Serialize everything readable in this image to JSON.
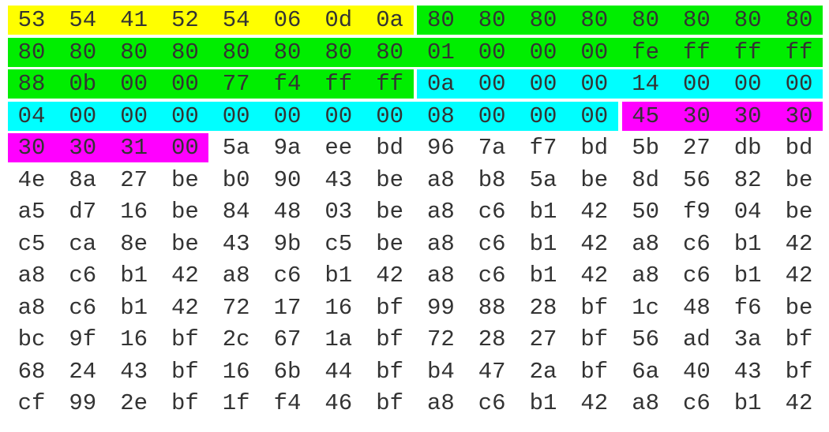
{
  "highlight_colors": {
    "yellow": "#ffff00",
    "green": "#00ee00",
    "cyan": "#00ffff",
    "magenta": "#ff00ff"
  },
  "text_color": "#333333",
  "rows": [
    {
      "bytes": [
        "53",
        "54",
        "41",
        "52",
        "54",
        "06",
        "0d",
        "0a",
        "80",
        "80",
        "80",
        "80",
        "80",
        "80",
        "80",
        "80"
      ],
      "highlights": [
        {
          "start": 0,
          "end": 7,
          "color": "yellow"
        },
        {
          "start": 8,
          "end": 15,
          "color": "green"
        }
      ]
    },
    {
      "bytes": [
        "80",
        "80",
        "80",
        "80",
        "80",
        "80",
        "80",
        "80",
        "01",
        "00",
        "00",
        "00",
        "fe",
        "ff",
        "ff",
        "ff"
      ],
      "highlights": [
        {
          "start": 0,
          "end": 15,
          "color": "green"
        }
      ]
    },
    {
      "bytes": [
        "88",
        "0b",
        "00",
        "00",
        "77",
        "f4",
        "ff",
        "ff",
        "0a",
        "00",
        "00",
        "00",
        "14",
        "00",
        "00",
        "00"
      ],
      "highlights": [
        {
          "start": 0,
          "end": 7,
          "color": "green"
        },
        {
          "start": 8,
          "end": 15,
          "color": "cyan"
        }
      ]
    },
    {
      "bytes": [
        "04",
        "00",
        "00",
        "00",
        "00",
        "00",
        "00",
        "00",
        "08",
        "00",
        "00",
        "00",
        "45",
        "30",
        "30",
        "30"
      ],
      "highlights": [
        {
          "start": 0,
          "end": 11,
          "color": "cyan"
        },
        {
          "start": 12,
          "end": 15,
          "color": "magenta"
        }
      ]
    },
    {
      "bytes": [
        "30",
        "30",
        "31",
        "00",
        "5a",
        "9a",
        "ee",
        "bd",
        "96",
        "7a",
        "f7",
        "bd",
        "5b",
        "27",
        "db",
        "bd"
      ],
      "highlights": [
        {
          "start": 0,
          "end": 3,
          "color": "magenta"
        }
      ]
    },
    {
      "bytes": [
        "4e",
        "8a",
        "27",
        "be",
        "b0",
        "90",
        "43",
        "be",
        "a8",
        "b8",
        "5a",
        "be",
        "8d",
        "56",
        "82",
        "be"
      ],
      "highlights": []
    },
    {
      "bytes": [
        "a5",
        "d7",
        "16",
        "be",
        "84",
        "48",
        "03",
        "be",
        "a8",
        "c6",
        "b1",
        "42",
        "50",
        "f9",
        "04",
        "be"
      ],
      "highlights": []
    },
    {
      "bytes": [
        "c5",
        "ca",
        "8e",
        "be",
        "43",
        "9b",
        "c5",
        "be",
        "a8",
        "c6",
        "b1",
        "42",
        "a8",
        "c6",
        "b1",
        "42"
      ],
      "highlights": []
    },
    {
      "bytes": [
        "a8",
        "c6",
        "b1",
        "42",
        "a8",
        "c6",
        "b1",
        "42",
        "a8",
        "c6",
        "b1",
        "42",
        "a8",
        "c6",
        "b1",
        "42"
      ],
      "highlights": []
    },
    {
      "bytes": [
        "a8",
        "c6",
        "b1",
        "42",
        "72",
        "17",
        "16",
        "bf",
        "99",
        "88",
        "28",
        "bf",
        "1c",
        "48",
        "f6",
        "be"
      ],
      "highlights": []
    },
    {
      "bytes": [
        "bc",
        "9f",
        "16",
        "bf",
        "2c",
        "67",
        "1a",
        "bf",
        "72",
        "28",
        "27",
        "bf",
        "56",
        "ad",
        "3a",
        "bf"
      ],
      "highlights": []
    },
    {
      "bytes": [
        "68",
        "24",
        "43",
        "bf",
        "16",
        "6b",
        "44",
        "bf",
        "b4",
        "47",
        "2a",
        "bf",
        "6a",
        "40",
        "43",
        "bf"
      ],
      "highlights": []
    },
    {
      "bytes": [
        "cf",
        "99",
        "2e",
        "bf",
        "1f",
        "f4",
        "46",
        "bf",
        "a8",
        "c6",
        "b1",
        "42",
        "a8",
        "c6",
        "b1",
        "42"
      ],
      "highlights": []
    }
  ]
}
